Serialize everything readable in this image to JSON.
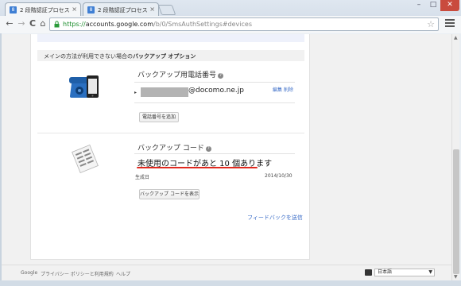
{
  "browser": {
    "tabs": [
      {
        "title": "2 段階認証プロセス",
        "favicon": "8"
      },
      {
        "title": "2 段階認証プロセス",
        "favicon": "8"
      }
    ],
    "url": {
      "scheme": "https://",
      "host": "accounts.google.com",
      "path": "/b/0/SmsAuthSettings#devices"
    },
    "icons": {
      "back": "←",
      "forward": "→",
      "reload": "C",
      "home": "⌂",
      "star": "☆",
      "tab_close": "×",
      "minimize": "–",
      "maximize": "□",
      "close": "✕"
    }
  },
  "page": {
    "section_heading_prefix": "メインの方法が利用できない場合の",
    "section_heading_bold": "バックアップ オプション",
    "backup_phone": {
      "title": "バックアップ用電話番号",
      "number_suffix": "@docomo.ne.jp",
      "edit_label": "編集",
      "delete_label": "削除",
      "add_button": "電話番号を追加"
    },
    "backup_codes": {
      "title": "バックアップ コード",
      "remaining_text": "未使用のコードがあと 10 個あります",
      "generated_label": "生成日",
      "generated_date": "2014/10/30",
      "show_button": "バックアップ コードを表示"
    },
    "feedback_link": "フィードバックを送信"
  },
  "footer": {
    "google": "Google",
    "privacy": "プライバシー ポリシーと利用規約",
    "help": "ヘルプ",
    "language": "日本語"
  },
  "colors": {
    "link": "#3a6cc7",
    "underline_red": "#e0291f",
    "url_green": "#1e8e2e",
    "close_button": "#c94b3d"
  }
}
